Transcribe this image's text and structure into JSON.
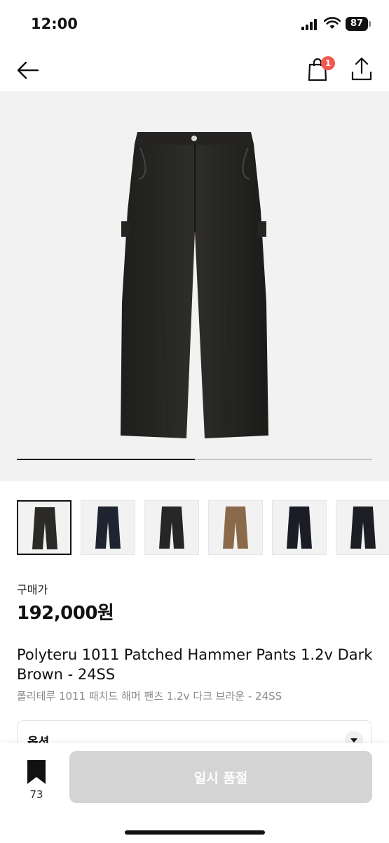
{
  "status_bar": {
    "time": "12:00",
    "battery": "87"
  },
  "nav": {
    "cart_badge": "1"
  },
  "gallery": {
    "progress": 0.5,
    "thumbnail_colors": [
      "#2b2a27",
      "#1e2430",
      "#262626",
      "#8a6a4a",
      "#1a1d26",
      "#1c1e24"
    ],
    "selected_thumbnail": 0
  },
  "product": {
    "price_label": "구매가",
    "price": "192,000원",
    "title": "Polyteru 1011 Patched Hammer Pants 1.2v Dark Brown - 24SS",
    "subtitle": "폴리테루 1011 패치드 해머 팬츠 1.2v  다크 브라운 - 24SS"
  },
  "options": {
    "label": "옵션"
  },
  "bottom_bar": {
    "bookmark_count": "73",
    "cta_label": "일시 품절"
  }
}
